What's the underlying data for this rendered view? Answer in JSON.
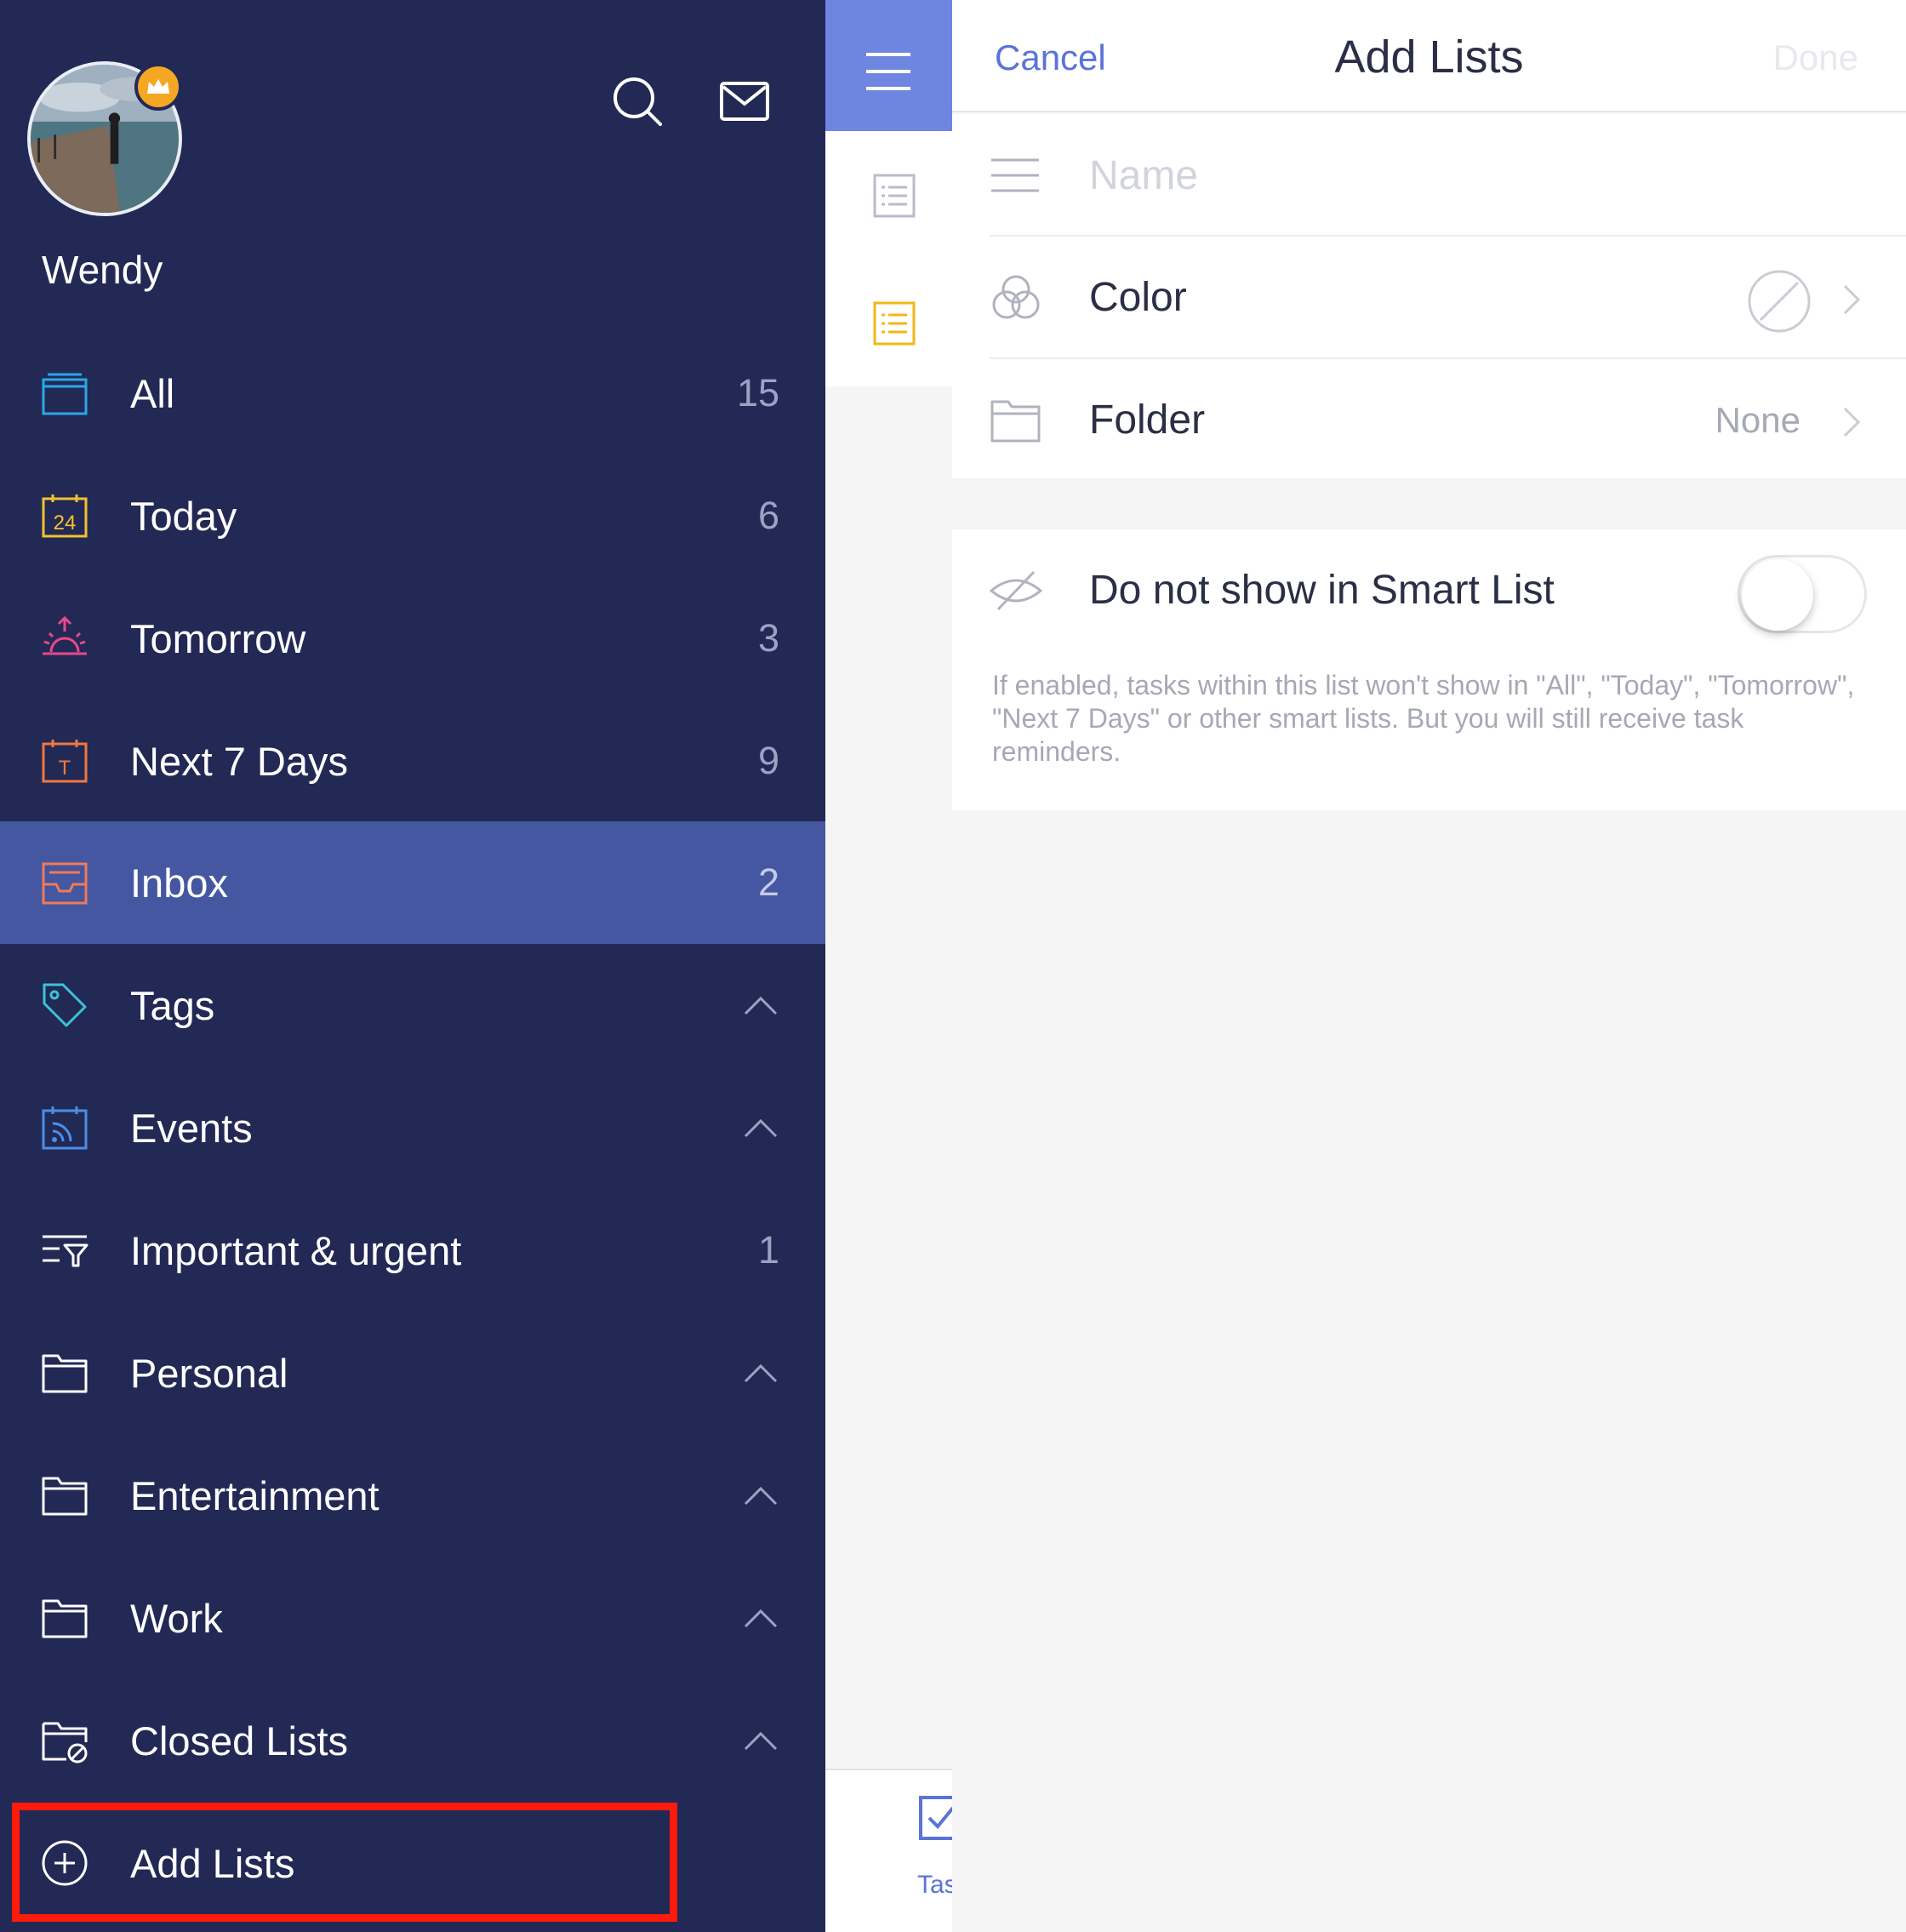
{
  "sidebar": {
    "username": "Wendy",
    "items": [
      {
        "label": "All",
        "count": "15"
      },
      {
        "label": "Today",
        "count": "6",
        "icon_text": "24"
      },
      {
        "label": "Tomorrow",
        "count": "3"
      },
      {
        "label": "Next 7 Days",
        "count": "9",
        "icon_text": "T"
      },
      {
        "label": "Inbox",
        "count": "2"
      },
      {
        "label": "Tags"
      },
      {
        "label": "Events"
      },
      {
        "label": "Important & urgent",
        "count": "1"
      },
      {
        "label": "Personal"
      },
      {
        "label": "Entertainment"
      },
      {
        "label": "Work"
      },
      {
        "label": "Closed Lists"
      },
      {
        "label": "Add Lists"
      }
    ]
  },
  "strip": {
    "tab_label": "Tas"
  },
  "panel": {
    "cancel": "Cancel",
    "title": "Add Lists",
    "done": "Done",
    "name_placeholder": "Name",
    "color_label": "Color",
    "folder_label": "Folder",
    "folder_value": "None",
    "smart_label": "Do not show in Smart List",
    "smart_enabled": false,
    "hint": "If enabled, tasks within this list won't show in \"All\", \"Today\", \"Tomorrow\", \"Next 7 Days\" or other smart lists. But you will still receive task reminders."
  },
  "colors": {
    "sidebar_bg": "#232955",
    "active_row": "#4457a0",
    "accent": "#5b73d8",
    "highlight_box": "#ff1a0c"
  }
}
